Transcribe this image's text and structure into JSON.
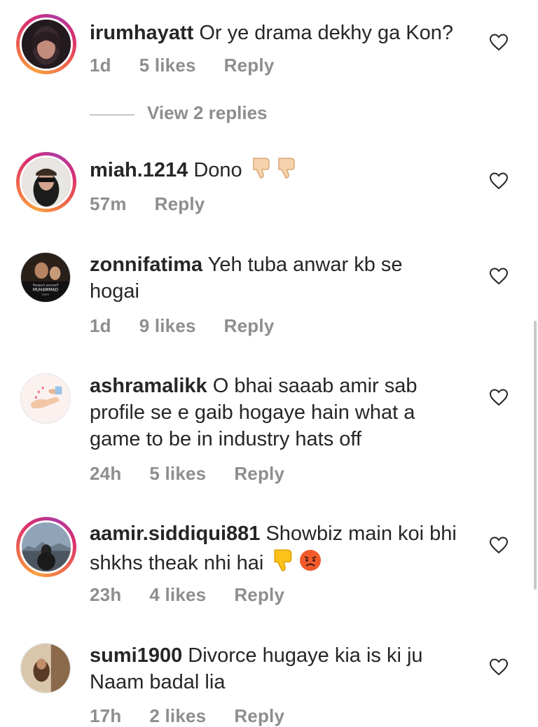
{
  "comments": [
    {
      "username": "irumhayatt",
      "text": "Or ye drama dekhy ga Kon?",
      "time": "1d",
      "likes": "5 likes",
      "reply": "Reply",
      "view_replies": "View 2 replies"
    },
    {
      "username": "miah.1214",
      "text": "Dono",
      "time": "57m",
      "likes": "",
      "reply": "Reply",
      "emoji": [
        "thumbs-down-icon",
        "thumbs-down-icon"
      ]
    },
    {
      "username": "zonnifatima",
      "text": "Yeh tuba anwar kb se hogai",
      "time": "1d",
      "likes": "9 likes",
      "reply": "Reply",
      "avatar_text": [
        "Respect yourself",
        "MUHAMMAD",
        "Islam"
      ]
    },
    {
      "username": "ashramalikk",
      "text": "O bhai saaab amir sab profile se e gaib hogaye hain what a game to be in industry hats off",
      "time": "24h",
      "likes": "5 likes",
      "reply": "Reply"
    },
    {
      "username": "aamir.siddiqui881",
      "text": "Showbiz main koi bhi shkhs theak nhi hai",
      "time": "23h",
      "likes": "4 likes",
      "reply": "Reply",
      "emoji": [
        "thumbs-down-icon",
        "angry-face-icon"
      ]
    },
    {
      "username": "sumi1900",
      "text": "Divorce hugaye kia is ki ju Naam badal lia",
      "time": "17h",
      "likes": "2 likes",
      "reply": "Reply"
    }
  ],
  "colors": {
    "text": "#262626",
    "meta": "#8e8e8e",
    "story_ring": "#d92e6f"
  }
}
